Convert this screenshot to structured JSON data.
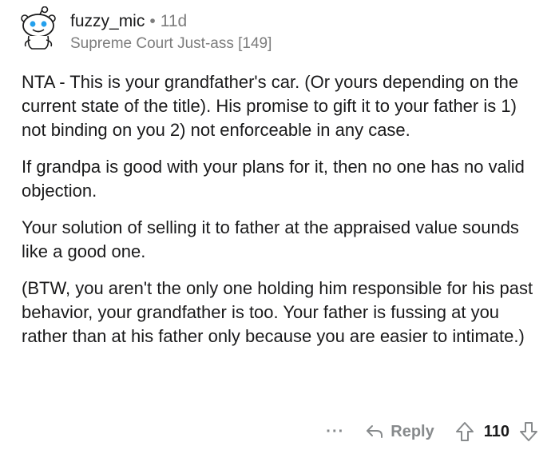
{
  "author": {
    "username": "fuzzy_mic",
    "separator": "•",
    "age": "11d",
    "flair": "Supreme Court Just-ass [149]",
    "avatar_icon": "snoo-avatar-icon"
  },
  "comment": {
    "paragraphs": [
      "NTA - This is your grandfather's car. (Or yours depending on the current state of the title). His promise to gift it to your father is 1) not binding on you 2) not enforceable in any case.",
      "If grandpa is good with your plans for it, then no one has no valid objection.",
      "Your solution of selling it to father at the appraised value sounds like a good one.",
      "(BTW, you aren't the only one holding him responsible for his past behavior, your grandfather is too. Your father is fussing at you rather than at his father only because you are easier to intimate.)"
    ]
  },
  "actions": {
    "more_label": "···",
    "reply_label": "Reply",
    "score": "110",
    "icons": [
      "more-icon",
      "reply-arrow-icon",
      "upvote-icon",
      "downvote-icon"
    ]
  },
  "colors": {
    "text": "#1a1a1b",
    "meta": "#7c7c7c",
    "action": "#878a8c"
  }
}
